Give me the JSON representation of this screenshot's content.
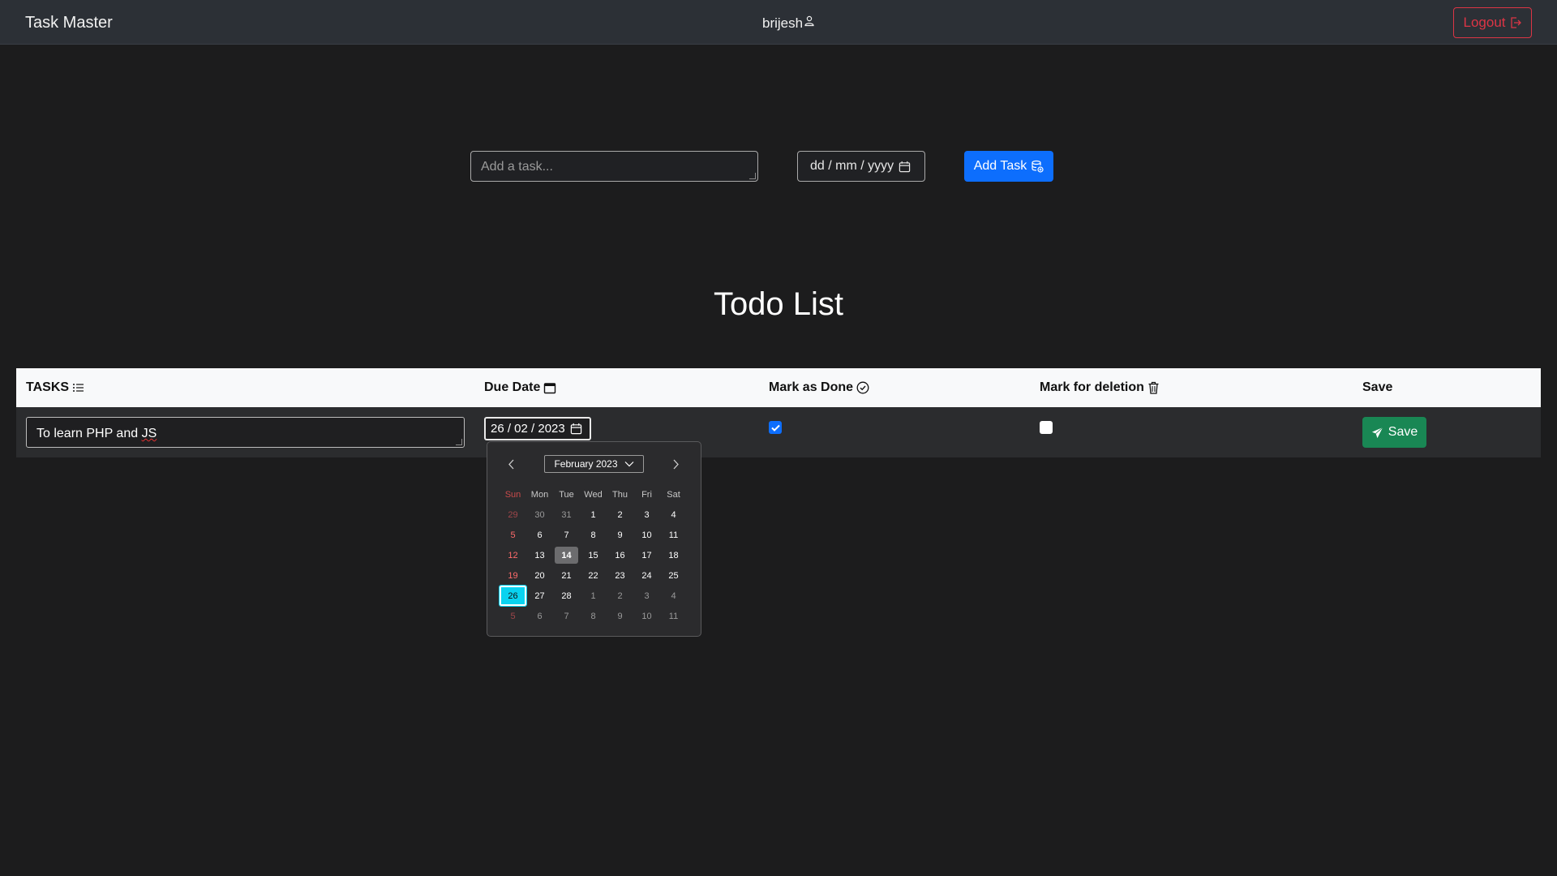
{
  "navbar": {
    "brand": "Task Master",
    "username": "brijesh",
    "logout_label": "Logout"
  },
  "add_form": {
    "task_placeholder": "Add a task...",
    "date_placeholder": "dd / mm / yyyy",
    "add_button_label": "Add Task"
  },
  "page_title": "Todo List",
  "table": {
    "headers": {
      "tasks": "TASKS",
      "due_date": "Due Date",
      "mark_done": "Mark as Done",
      "mark_delete": "Mark for deletion",
      "save": "Save"
    },
    "rows": [
      {
        "task_prefix": "To learn PHP and ",
        "task_suffix": "JS",
        "due_date": "26 / 02 / 2023",
        "done": true,
        "delete": false,
        "save_label": "Save"
      }
    ]
  },
  "calendar": {
    "month_label": "February 2023",
    "weekdays": [
      "Sun",
      "Mon",
      "Tue",
      "Wed",
      "Thu",
      "Fri",
      "Sat"
    ],
    "today": "14",
    "selected": "26",
    "weeks": [
      [
        "29",
        "30",
        "31",
        "1",
        "2",
        "3",
        "4"
      ],
      [
        "5",
        "6",
        "7",
        "8",
        "9",
        "10",
        "11"
      ],
      [
        "12",
        "13",
        "14",
        "15",
        "16",
        "17",
        "18"
      ],
      [
        "19",
        "20",
        "21",
        "22",
        "23",
        "24",
        "25"
      ],
      [
        "26",
        "27",
        "28",
        "1",
        "2",
        "3",
        "4"
      ],
      [
        "5",
        "6",
        "7",
        "8",
        "9",
        "10",
        "11"
      ]
    ]
  },
  "colors": {
    "primary": "#0d6efd",
    "success": "#198754",
    "danger": "#dc3545",
    "selected_day": "#09d3f0"
  }
}
